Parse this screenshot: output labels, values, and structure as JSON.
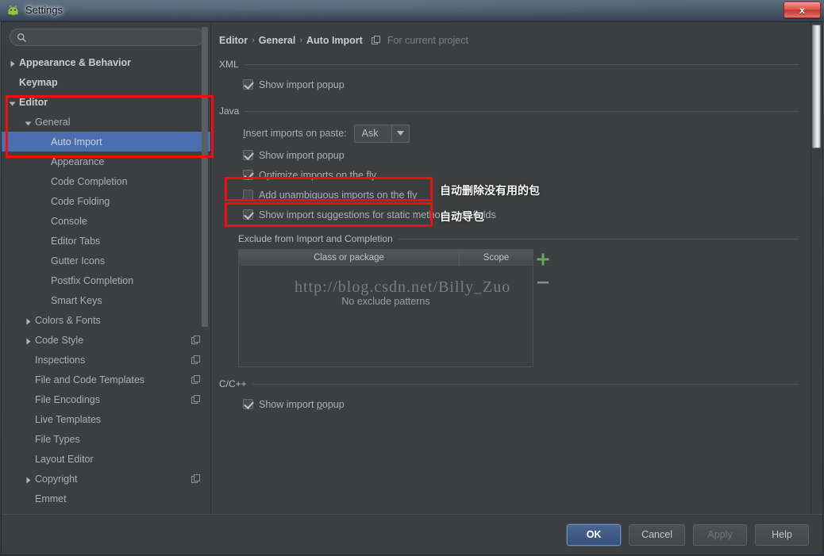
{
  "window": {
    "title": "Settings",
    "app_icon": "android-studio-icon",
    "close_label": "x"
  },
  "search": {
    "value": "",
    "placeholder": "",
    "icon": "search-icon"
  },
  "sidebar": {
    "scrollbar": "vertical-scrollbar",
    "items": [
      {
        "label": "Appearance & Behavior",
        "indent": 0,
        "arrow": "collapsed",
        "bold": true,
        "selected": false,
        "module_icon": false
      },
      {
        "label": "Keymap",
        "indent": 0,
        "arrow": "none",
        "bold": true,
        "selected": false,
        "module_icon": false
      },
      {
        "label": "Editor",
        "indent": 0,
        "arrow": "expanded",
        "bold": true,
        "selected": false,
        "module_icon": false
      },
      {
        "label": "General",
        "indent": 1,
        "arrow": "expanded",
        "bold": false,
        "selected": false,
        "module_icon": false
      },
      {
        "label": "Auto Import",
        "indent": 2,
        "arrow": "none",
        "bold": false,
        "selected": true,
        "module_icon": false
      },
      {
        "label": "Appearance",
        "indent": 2,
        "arrow": "none",
        "bold": false,
        "selected": false,
        "module_icon": false
      },
      {
        "label": "Code Completion",
        "indent": 2,
        "arrow": "none",
        "bold": false,
        "selected": false,
        "module_icon": false
      },
      {
        "label": "Code Folding",
        "indent": 2,
        "arrow": "none",
        "bold": false,
        "selected": false,
        "module_icon": false
      },
      {
        "label": "Console",
        "indent": 2,
        "arrow": "none",
        "bold": false,
        "selected": false,
        "module_icon": false
      },
      {
        "label": "Editor Tabs",
        "indent": 2,
        "arrow": "none",
        "bold": false,
        "selected": false,
        "module_icon": false
      },
      {
        "label": "Gutter Icons",
        "indent": 2,
        "arrow": "none",
        "bold": false,
        "selected": false,
        "module_icon": false
      },
      {
        "label": "Postfix Completion",
        "indent": 2,
        "arrow": "none",
        "bold": false,
        "selected": false,
        "module_icon": false
      },
      {
        "label": "Smart Keys",
        "indent": 2,
        "arrow": "none",
        "bold": false,
        "selected": false,
        "module_icon": false
      },
      {
        "label": "Colors & Fonts",
        "indent": 1,
        "arrow": "collapsed",
        "bold": false,
        "selected": false,
        "module_icon": false
      },
      {
        "label": "Code Style",
        "indent": 1,
        "arrow": "collapsed",
        "bold": false,
        "selected": false,
        "module_icon": true
      },
      {
        "label": "Inspections",
        "indent": 1,
        "arrow": "none",
        "bold": false,
        "selected": false,
        "module_icon": true
      },
      {
        "label": "File and Code Templates",
        "indent": 1,
        "arrow": "none",
        "bold": false,
        "selected": false,
        "module_icon": true
      },
      {
        "label": "File Encodings",
        "indent": 1,
        "arrow": "none",
        "bold": false,
        "selected": false,
        "module_icon": true
      },
      {
        "label": "Live Templates",
        "indent": 1,
        "arrow": "none",
        "bold": false,
        "selected": false,
        "module_icon": false
      },
      {
        "label": "File Types",
        "indent": 1,
        "arrow": "none",
        "bold": false,
        "selected": false,
        "module_icon": false
      },
      {
        "label": "Layout Editor",
        "indent": 1,
        "arrow": "none",
        "bold": false,
        "selected": false,
        "module_icon": false
      },
      {
        "label": "Copyright",
        "indent": 1,
        "arrow": "collapsed",
        "bold": false,
        "selected": false,
        "module_icon": true
      },
      {
        "label": "Emmet",
        "indent": 1,
        "arrow": "none",
        "bold": false,
        "selected": false,
        "module_icon": false
      }
    ]
  },
  "breadcrumb": {
    "crumbs": [
      "Editor",
      "General",
      "Auto Import"
    ],
    "separator": "›",
    "project_icon": "module-icon",
    "project_scope": "For current project"
  },
  "sections": {
    "xml": {
      "title": "XML",
      "show_import_popup": {
        "label": "Show import popup",
        "checked": true
      }
    },
    "java": {
      "title": "Java",
      "insert_imports_label": "Insert imports on paste:",
      "insert_imports_mnemonic": "I",
      "insert_imports_value": "Ask",
      "dropdown_icon": "chevron-down-icon",
      "checkboxes": [
        {
          "label": "Show import popup",
          "checked": true,
          "mnemonic": ""
        },
        {
          "label": "Optimize imports on the fly",
          "checked": true,
          "mnemonic": ""
        },
        {
          "label": "Add unambiguous imports on the fly",
          "checked": false,
          "mnemonic": ""
        },
        {
          "label": "Show import suggestions for static methods and fields",
          "checked": true,
          "mnemonic": ""
        }
      ]
    },
    "exclude": {
      "title": "Exclude from Import and Completion",
      "columns": [
        "Class or package",
        "Scope"
      ],
      "rows": [],
      "empty_text": "No exclude patterns",
      "add_icon": "plus-icon",
      "remove_icon": "minus-icon"
    },
    "cpp": {
      "title": "C/C++",
      "show_import_popup": {
        "label": "Show import popup",
        "checked": true,
        "mnemonic": "p"
      }
    }
  },
  "footer": {
    "ok": "OK",
    "cancel": "Cancel",
    "apply": "Apply",
    "help": "Help"
  },
  "annotations": {
    "note_optimize": "自动删除没有用的包",
    "note_add": "自动导包",
    "highlight_color": "#f50d0d"
  },
  "watermark": "http://blog.csdn.net/Billy_Zuo"
}
